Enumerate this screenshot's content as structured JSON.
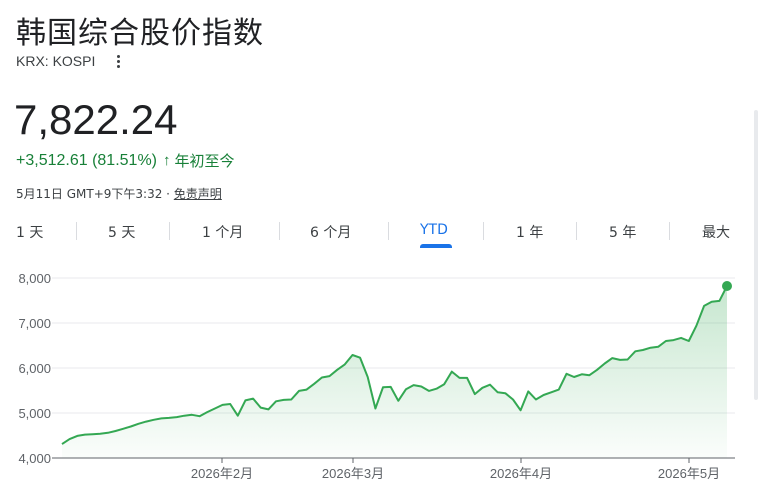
{
  "header": {
    "title": "韩国综合股价指数",
    "ticker": "KRX: KOSPI",
    "more_icon": "more-vert-icon"
  },
  "quote": {
    "price": "7,822.24",
    "change": "+3,512.61 (81.51%)",
    "change_arrow": "↑",
    "period": "年初至今",
    "timestamp": "5月11日 GMT+9下午3:32 · ",
    "disclaimer": "免责声明"
  },
  "tabs": [
    {
      "label": "1 天",
      "active": false
    },
    {
      "label": "5 天",
      "active": false
    },
    {
      "label": "1 个月",
      "active": false
    },
    {
      "label": "6 个月",
      "active": false
    },
    {
      "label": "YTD",
      "active": true
    },
    {
      "label": "1 年",
      "active": false
    },
    {
      "label": "5 年",
      "active": false
    },
    {
      "label": "最大",
      "active": false
    }
  ],
  "colors": {
    "line": "#34a853",
    "up": "#188038",
    "accent": "#1a73e8",
    "grid": "#e8eaed",
    "axis_text": "#5f6368"
  },
  "chart_data": {
    "type": "area",
    "y_ticks": [
      "8,000",
      "7,000",
      "6,000",
      "5,000",
      "4,000"
    ],
    "x_ticks": [
      "2026年2月",
      "2026年3月",
      "2026年4月",
      "2026年5月"
    ],
    "ylim": [
      4000,
      8000
    ],
    "grid": true,
    "last_value": 7822.24,
    "values": [
      4309,
      4420,
      4490,
      4520,
      4530,
      4540,
      4560,
      4600,
      4650,
      4700,
      4760,
      4810,
      4850,
      4880,
      4890,
      4910,
      4940,
      4960,
      4930,
      5020,
      5100,
      5180,
      5200,
      4940,
      5280,
      5320,
      5120,
      5080,
      5260,
      5290,
      5300,
      5490,
      5520,
      5650,
      5790,
      5820,
      5960,
      6080,
      6290,
      6230,
      5800,
      5100,
      5570,
      5580,
      5270,
      5530,
      5620,
      5590,
      5490,
      5540,
      5640,
      5920,
      5780,
      5780,
      5420,
      5560,
      5630,
      5460,
      5440,
      5300,
      5060,
      5480,
      5300,
      5400,
      5460,
      5520,
      5870,
      5800,
      5860,
      5840,
      5960,
      6100,
      6220,
      6180,
      6190,
      6370,
      6400,
      6450,
      6470,
      6600,
      6620,
      6670,
      6600,
      6940,
      7380,
      7470,
      7490,
      7822
    ]
  }
}
